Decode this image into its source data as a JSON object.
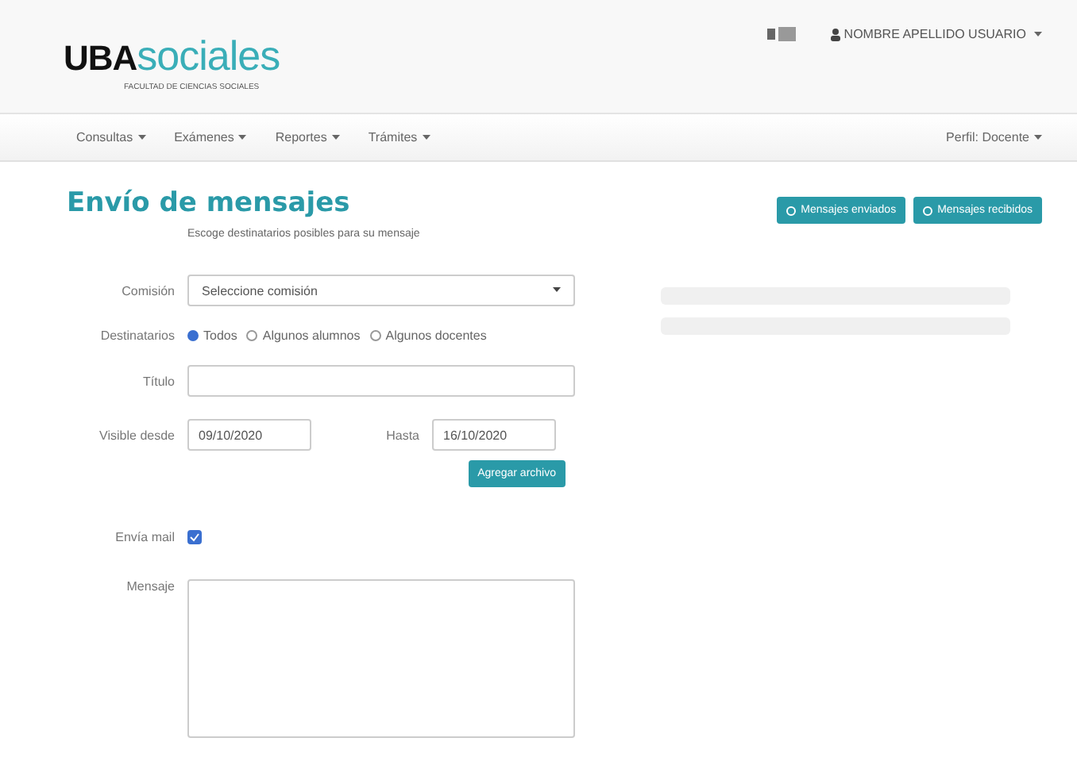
{
  "brand": {
    "bold": "UBA",
    "light": "sociales",
    "subtitle": "FACULTAD DE CIENCIAS SOCIALES"
  },
  "user": {
    "name": "NOMBRE APELLIDO USUARIO"
  },
  "nav": {
    "menus": [
      {
        "label": "Consultas"
      },
      {
        "label": "Exámenes"
      },
      {
        "label": "Reportes"
      },
      {
        "label": "Trámites"
      }
    ],
    "profile": "Perfil: Docente"
  },
  "page": {
    "title": "Envío de mensajes",
    "hint": "Escoge destinatarios posibles para su mensaje"
  },
  "actions": [
    {
      "label": "Mensajes enviados"
    },
    {
      "label": "Mensajes recibidos"
    }
  ],
  "form": {
    "commission": {
      "label": "Comisión",
      "value": "Seleccione comisión"
    },
    "recipients": {
      "label": "Destinatarios",
      "options": [
        {
          "label": "Todos",
          "selected": true
        },
        {
          "label": "Algunos alumnos",
          "selected": false
        },
        {
          "label": "Algunos docentes",
          "selected": false
        }
      ]
    },
    "title": {
      "label": "Título"
    },
    "visible_from": {
      "label": "Visible desde",
      "value": "09/10/2020"
    },
    "until": {
      "label": "Hasta",
      "value": "16/10/2020"
    },
    "attach": "Agregar archivo",
    "send_mail": {
      "label": "Envía mail",
      "checked": true
    },
    "message": {
      "label": "Mensaje"
    }
  }
}
